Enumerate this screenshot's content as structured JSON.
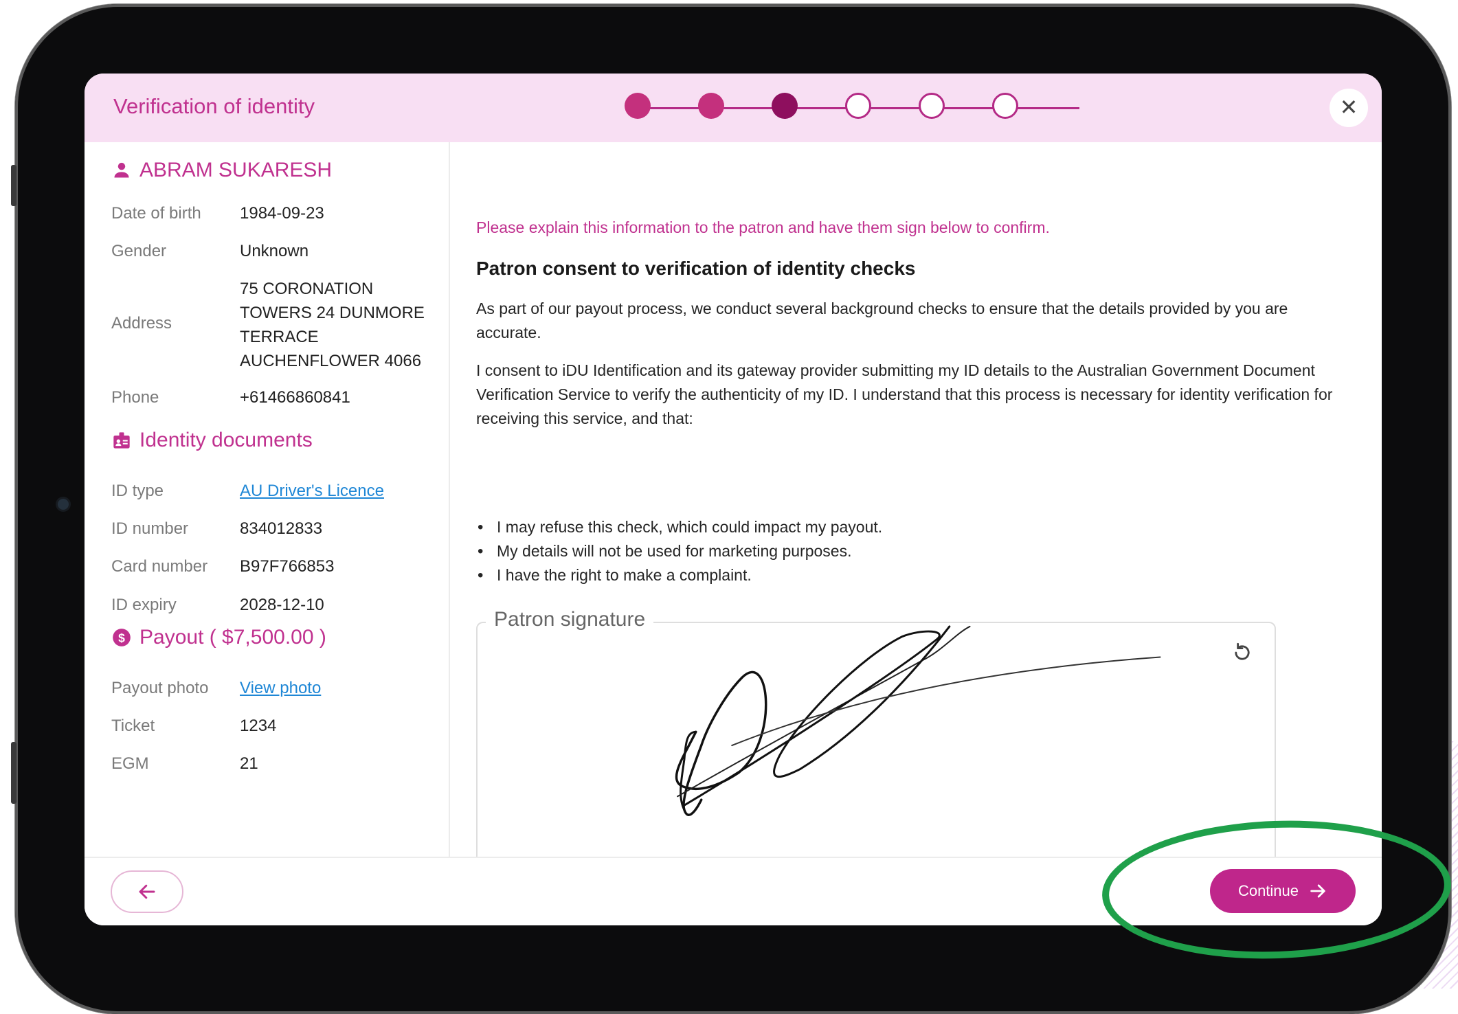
{
  "header": {
    "title": "Verification of identity",
    "steps": [
      "done",
      "done",
      "current",
      "todo",
      "todo",
      "todo"
    ],
    "close_glyph": "✕"
  },
  "patron": {
    "name": "ABRAM SUKARESH",
    "fields": {
      "dob_label": "Date of birth",
      "dob_value": "1984-09-23",
      "gender_label": "Gender",
      "gender_value": "Unknown",
      "address_label": "Address",
      "address_lines": [
        "75 CORONATION",
        "TOWERS 24 DUNMORE",
        "TERRACE",
        "AUCHENFLOWER 4066"
      ],
      "phone_label": "Phone",
      "phone_value": "+61466860841"
    }
  },
  "identity": {
    "heading": "Identity documents",
    "id_type_label": "ID type",
    "id_type_value": "AU Driver's Licence",
    "id_number_label": "ID number",
    "id_number_value": "834012833",
    "card_number_label": "Card number",
    "card_number_value": "B97F766853",
    "id_expiry_label": "ID expiry",
    "id_expiry_value": "2028-12-10"
  },
  "payout": {
    "heading": "Payout ( $7,500.00 )",
    "photo_label": "Payout photo",
    "photo_link": "View photo",
    "ticket_label": "Ticket",
    "ticket_value": "1234",
    "egm_label": "EGM",
    "egm_value": "21"
  },
  "consent": {
    "instruction": "Please explain this information to the patron and have them sign below to confirm.",
    "title": "Patron consent to verification of identity checks",
    "para1": "As part of our payout process, we conduct several background checks to ensure that the details provided by you are accurate.",
    "para2": "I consent to iDU Identification and its gateway provider submitting my ID details to the Australian Government Document Verification Service to verify the authenticity of my ID. I understand that this process is necessary for identity verification for receiving this service, and that:",
    "bullets": [
      "I may refuse this check, which could impact my payout.",
      "My details will not be used for marketing purposes.",
      "I have the right to make a complaint."
    ],
    "signature_label": "Patron signature"
  },
  "footer": {
    "continue_label": "Continue"
  },
  "colors": {
    "accent": "#c0318f",
    "header_bg": "#f8dff3",
    "link": "#1f87d6",
    "highlight": "#1fa04a"
  },
  "icons": [
    "person-icon",
    "id-badge-icon",
    "dollar-circle-icon",
    "close-icon",
    "reset-icon",
    "arrow-left-icon",
    "arrow-right-icon"
  ]
}
